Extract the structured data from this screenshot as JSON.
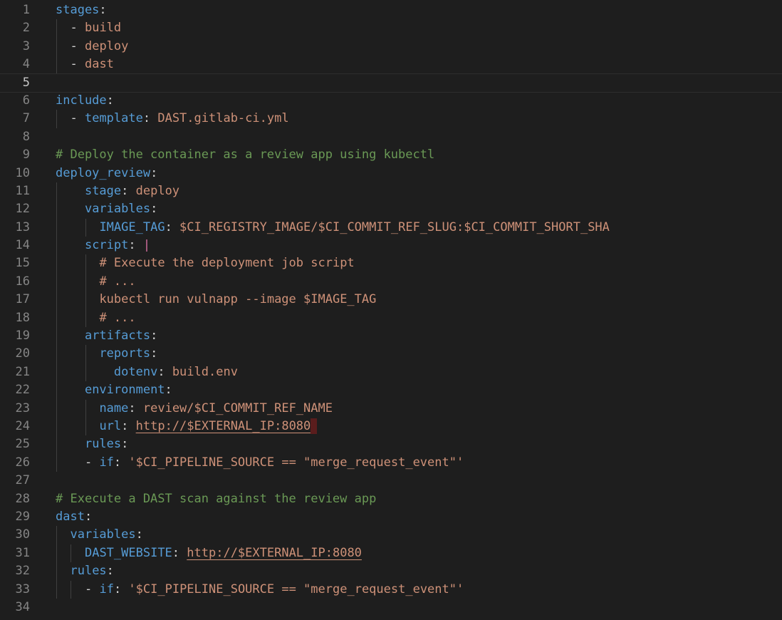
{
  "editor": {
    "active_line": 5,
    "colors": {
      "background": "#1e1e1e",
      "key": "#569cd6",
      "string": "#ce9178",
      "comment": "#6a9955",
      "line_number": "#858585"
    },
    "lines": [
      {
        "n": "1",
        "indent": 0,
        "tokens": [
          [
            "key",
            "stages"
          ],
          [
            "pun",
            ":"
          ]
        ]
      },
      {
        "n": "2",
        "indent": 2,
        "tokens": [
          [
            "pun",
            "- "
          ],
          [
            "str",
            "build"
          ]
        ]
      },
      {
        "n": "3",
        "indent": 2,
        "tokens": [
          [
            "pun",
            "- "
          ],
          [
            "str",
            "deploy"
          ]
        ]
      },
      {
        "n": "4",
        "indent": 2,
        "tokens": [
          [
            "pun",
            "- "
          ],
          [
            "str",
            "dast"
          ]
        ]
      },
      {
        "n": "5",
        "indent": 0,
        "tokens": []
      },
      {
        "n": "6",
        "indent": 0,
        "tokens": [
          [
            "key",
            "include"
          ],
          [
            "pun",
            ":"
          ]
        ]
      },
      {
        "n": "7",
        "indent": 2,
        "tokens": [
          [
            "pun",
            "- "
          ],
          [
            "key",
            "template"
          ],
          [
            "pun",
            ": "
          ],
          [
            "str",
            "DAST.gitlab-ci.yml"
          ]
        ]
      },
      {
        "n": "8",
        "indent": 0,
        "tokens": []
      },
      {
        "n": "9",
        "indent": 0,
        "tokens": [
          [
            "com",
            "# Deploy the container as a review app using kubectl"
          ]
        ]
      },
      {
        "n": "10",
        "indent": 0,
        "tokens": [
          [
            "key",
            "deploy_review"
          ],
          [
            "pun",
            ":"
          ]
        ]
      },
      {
        "n": "11",
        "indent": 4,
        "tokens": [
          [
            "key",
            "stage"
          ],
          [
            "pun",
            ": "
          ],
          [
            "str",
            "deploy"
          ]
        ]
      },
      {
        "n": "12",
        "indent": 4,
        "tokens": [
          [
            "key",
            "variables"
          ],
          [
            "pun",
            ":"
          ]
        ]
      },
      {
        "n": "13",
        "indent": 6,
        "tokens": [
          [
            "key",
            "IMAGE_TAG"
          ],
          [
            "pun",
            ": "
          ],
          [
            "str",
            "$CI_REGISTRY_IMAGE/$CI_COMMIT_REF_SLUG:$CI_COMMIT_SHORT_SHA"
          ]
        ]
      },
      {
        "n": "14",
        "indent": 4,
        "tokens": [
          [
            "key",
            "script"
          ],
          [
            "pun",
            ": "
          ],
          [
            "pipe",
            "|"
          ]
        ]
      },
      {
        "n": "15",
        "indent": 6,
        "tokens": [
          [
            "str",
            "# Execute the deployment job script"
          ]
        ]
      },
      {
        "n": "16",
        "indent": 6,
        "tokens": [
          [
            "str",
            "# ..."
          ]
        ]
      },
      {
        "n": "17",
        "indent": 6,
        "tokens": [
          [
            "str",
            "kubectl run vulnapp --image $IMAGE_TAG"
          ]
        ]
      },
      {
        "n": "18",
        "indent": 6,
        "tokens": [
          [
            "str",
            "# ..."
          ]
        ]
      },
      {
        "n": "19",
        "indent": 4,
        "tokens": [
          [
            "key",
            "artifacts"
          ],
          [
            "pun",
            ":"
          ]
        ]
      },
      {
        "n": "20",
        "indent": 6,
        "tokens": [
          [
            "key",
            "reports"
          ],
          [
            "pun",
            ":"
          ]
        ]
      },
      {
        "n": "21",
        "indent": 8,
        "tokens": [
          [
            "key",
            "dotenv"
          ],
          [
            "pun",
            ": "
          ],
          [
            "str",
            "build.env"
          ]
        ]
      },
      {
        "n": "22",
        "indent": 4,
        "tokens": [
          [
            "key",
            "environment"
          ],
          [
            "pun",
            ":"
          ]
        ]
      },
      {
        "n": "23",
        "indent": 6,
        "tokens": [
          [
            "key",
            "name"
          ],
          [
            "pun",
            ": "
          ],
          [
            "str",
            "review/$CI_COMMIT_REF_NAME"
          ]
        ]
      },
      {
        "n": "24",
        "indent": 6,
        "tokens": [
          [
            "key",
            "url"
          ],
          [
            "pun",
            ": "
          ],
          [
            "link",
            "http://$EXTERNAL_IP:8080"
          ],
          [
            "ws",
            " "
          ]
        ]
      },
      {
        "n": "25",
        "indent": 4,
        "tokens": [
          [
            "key",
            "rules"
          ],
          [
            "pun",
            ":"
          ]
        ]
      },
      {
        "n": "26",
        "indent": 4,
        "tokens": [
          [
            "pun",
            "- "
          ],
          [
            "key",
            "if"
          ],
          [
            "pun",
            ": "
          ],
          [
            "str",
            "'$CI_PIPELINE_SOURCE == \"merge_request_event\"'"
          ]
        ]
      },
      {
        "n": "27",
        "indent": 0,
        "tokens": []
      },
      {
        "n": "28",
        "indent": 0,
        "tokens": [
          [
            "com",
            "# Execute a DAST scan against the review app"
          ]
        ]
      },
      {
        "n": "29",
        "indent": 0,
        "tokens": [
          [
            "key",
            "dast"
          ],
          [
            "pun",
            ":"
          ]
        ]
      },
      {
        "n": "30",
        "indent": 2,
        "tokens": [
          [
            "key",
            "variables"
          ],
          [
            "pun",
            ":"
          ]
        ]
      },
      {
        "n": "31",
        "indent": 4,
        "tokens": [
          [
            "key",
            "DAST_WEBSITE"
          ],
          [
            "pun",
            ": "
          ],
          [
            "link",
            "http://$EXTERNAL_IP:8080"
          ]
        ]
      },
      {
        "n": "32",
        "indent": 2,
        "tokens": [
          [
            "key",
            "rules"
          ],
          [
            "pun",
            ":"
          ]
        ]
      },
      {
        "n": "33",
        "indent": 4,
        "tokens": [
          [
            "pun",
            "- "
          ],
          [
            "key",
            "if"
          ],
          [
            "pun",
            ": "
          ],
          [
            "str",
            "'$CI_PIPELINE_SOURCE == \"merge_request_event\"'"
          ]
        ]
      },
      {
        "n": "34",
        "indent": 0,
        "tokens": []
      }
    ]
  }
}
